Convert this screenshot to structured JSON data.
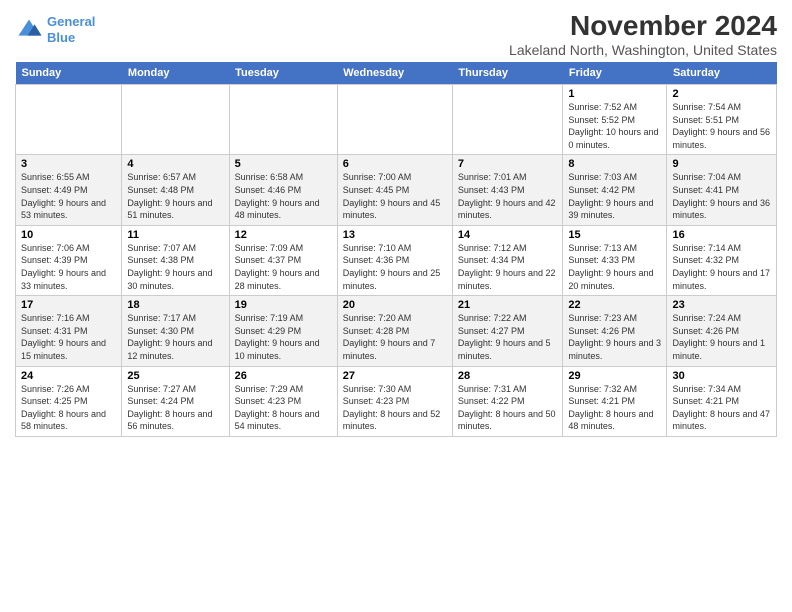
{
  "logo": {
    "line1": "General",
    "line2": "Blue"
  },
  "title": "November 2024",
  "subtitle": "Lakeland North, Washington, United States",
  "days_of_week": [
    "Sunday",
    "Monday",
    "Tuesday",
    "Wednesday",
    "Thursday",
    "Friday",
    "Saturday"
  ],
  "weeks": [
    [
      {
        "day": "",
        "info": ""
      },
      {
        "day": "",
        "info": ""
      },
      {
        "day": "",
        "info": ""
      },
      {
        "day": "",
        "info": ""
      },
      {
        "day": "",
        "info": ""
      },
      {
        "day": "1",
        "info": "Sunrise: 7:52 AM\nSunset: 5:52 PM\nDaylight: 10 hours and 0 minutes."
      },
      {
        "day": "2",
        "info": "Sunrise: 7:54 AM\nSunset: 5:51 PM\nDaylight: 9 hours and 56 minutes."
      }
    ],
    [
      {
        "day": "3",
        "info": "Sunrise: 6:55 AM\nSunset: 4:49 PM\nDaylight: 9 hours and 53 minutes."
      },
      {
        "day": "4",
        "info": "Sunrise: 6:57 AM\nSunset: 4:48 PM\nDaylight: 9 hours and 51 minutes."
      },
      {
        "day": "5",
        "info": "Sunrise: 6:58 AM\nSunset: 4:46 PM\nDaylight: 9 hours and 48 minutes."
      },
      {
        "day": "6",
        "info": "Sunrise: 7:00 AM\nSunset: 4:45 PM\nDaylight: 9 hours and 45 minutes."
      },
      {
        "day": "7",
        "info": "Sunrise: 7:01 AM\nSunset: 4:43 PM\nDaylight: 9 hours and 42 minutes."
      },
      {
        "day": "8",
        "info": "Sunrise: 7:03 AM\nSunset: 4:42 PM\nDaylight: 9 hours and 39 minutes."
      },
      {
        "day": "9",
        "info": "Sunrise: 7:04 AM\nSunset: 4:41 PM\nDaylight: 9 hours and 36 minutes."
      }
    ],
    [
      {
        "day": "10",
        "info": "Sunrise: 7:06 AM\nSunset: 4:39 PM\nDaylight: 9 hours and 33 minutes."
      },
      {
        "day": "11",
        "info": "Sunrise: 7:07 AM\nSunset: 4:38 PM\nDaylight: 9 hours and 30 minutes."
      },
      {
        "day": "12",
        "info": "Sunrise: 7:09 AM\nSunset: 4:37 PM\nDaylight: 9 hours and 28 minutes."
      },
      {
        "day": "13",
        "info": "Sunrise: 7:10 AM\nSunset: 4:36 PM\nDaylight: 9 hours and 25 minutes."
      },
      {
        "day": "14",
        "info": "Sunrise: 7:12 AM\nSunset: 4:34 PM\nDaylight: 9 hours and 22 minutes."
      },
      {
        "day": "15",
        "info": "Sunrise: 7:13 AM\nSunset: 4:33 PM\nDaylight: 9 hours and 20 minutes."
      },
      {
        "day": "16",
        "info": "Sunrise: 7:14 AM\nSunset: 4:32 PM\nDaylight: 9 hours and 17 minutes."
      }
    ],
    [
      {
        "day": "17",
        "info": "Sunrise: 7:16 AM\nSunset: 4:31 PM\nDaylight: 9 hours and 15 minutes."
      },
      {
        "day": "18",
        "info": "Sunrise: 7:17 AM\nSunset: 4:30 PM\nDaylight: 9 hours and 12 minutes."
      },
      {
        "day": "19",
        "info": "Sunrise: 7:19 AM\nSunset: 4:29 PM\nDaylight: 9 hours and 10 minutes."
      },
      {
        "day": "20",
        "info": "Sunrise: 7:20 AM\nSunset: 4:28 PM\nDaylight: 9 hours and 7 minutes."
      },
      {
        "day": "21",
        "info": "Sunrise: 7:22 AM\nSunset: 4:27 PM\nDaylight: 9 hours and 5 minutes."
      },
      {
        "day": "22",
        "info": "Sunrise: 7:23 AM\nSunset: 4:26 PM\nDaylight: 9 hours and 3 minutes."
      },
      {
        "day": "23",
        "info": "Sunrise: 7:24 AM\nSunset: 4:26 PM\nDaylight: 9 hours and 1 minute."
      }
    ],
    [
      {
        "day": "24",
        "info": "Sunrise: 7:26 AM\nSunset: 4:25 PM\nDaylight: 8 hours and 58 minutes."
      },
      {
        "day": "25",
        "info": "Sunrise: 7:27 AM\nSunset: 4:24 PM\nDaylight: 8 hours and 56 minutes."
      },
      {
        "day": "26",
        "info": "Sunrise: 7:29 AM\nSunset: 4:23 PM\nDaylight: 8 hours and 54 minutes."
      },
      {
        "day": "27",
        "info": "Sunrise: 7:30 AM\nSunset: 4:23 PM\nDaylight: 8 hours and 52 minutes."
      },
      {
        "day": "28",
        "info": "Sunrise: 7:31 AM\nSunset: 4:22 PM\nDaylight: 8 hours and 50 minutes."
      },
      {
        "day": "29",
        "info": "Sunrise: 7:32 AM\nSunset: 4:21 PM\nDaylight: 8 hours and 48 minutes."
      },
      {
        "day": "30",
        "info": "Sunrise: 7:34 AM\nSunset: 4:21 PM\nDaylight: 8 hours and 47 minutes."
      }
    ]
  ]
}
